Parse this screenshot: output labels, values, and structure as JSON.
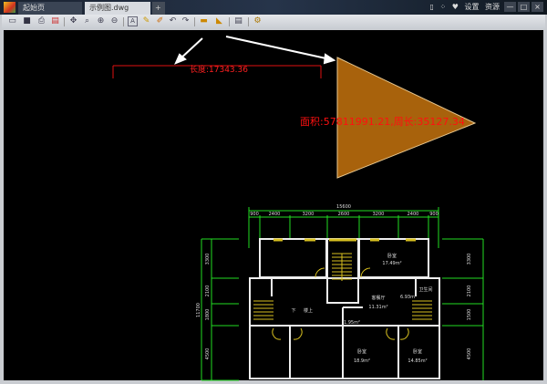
{
  "tabs": [
    {
      "label": "起始页"
    },
    {
      "label": "示例图.dwg"
    }
  ],
  "tab_add": "+",
  "titlebar_links": {
    "settings": "设置",
    "resources": "资源"
  },
  "window_buttons": {
    "minimize": "—",
    "maximize": "□",
    "close": "×"
  },
  "toolbar": [
    "open-icon",
    "save-icon",
    "print-icon",
    "pdf-icon",
    "pan-icon",
    "zoom-window-icon",
    "zoom-in-icon",
    "zoom-out-icon",
    "text-icon",
    "pencil-icon",
    "erase-icon",
    "undo-icon",
    "redo-icon",
    "measure-length-icon",
    "measure-area-icon",
    "layers-icon",
    "settings-icon"
  ],
  "measurements": {
    "length": "长度:17343.36",
    "area": "面积:57811991.21,周长:35127.34"
  },
  "colors": {
    "triangle": "#a8620c",
    "measure_text": "#ff1010",
    "plan_dim": "#22dd22"
  },
  "plan": {
    "total_width": "15600",
    "top_dims": [
      "900",
      "2400",
      "3200",
      "2600",
      "3200",
      "2400",
      "900"
    ],
    "left_dims": [
      "3300",
      "2100",
      "1800",
      "4500"
    ],
    "left_total": "11700",
    "right_dims": [
      "3300",
      "2100",
      "1500",
      "4500"
    ],
    "rooms": [
      {
        "name": "卧室",
        "area": "17.49m²"
      },
      {
        "name": "客餐厅",
        "area": "11.31m²"
      },
      {
        "name": "卫生间",
        "area": "6.93m²"
      },
      {
        "name": "卧室",
        "area": "18.9m²"
      },
      {
        "name": "卧室",
        "area": "14.85m²"
      }
    ],
    "labels": {
      "down": "下",
      "up": "楼上",
      "small_area": "1.95m²"
    }
  }
}
